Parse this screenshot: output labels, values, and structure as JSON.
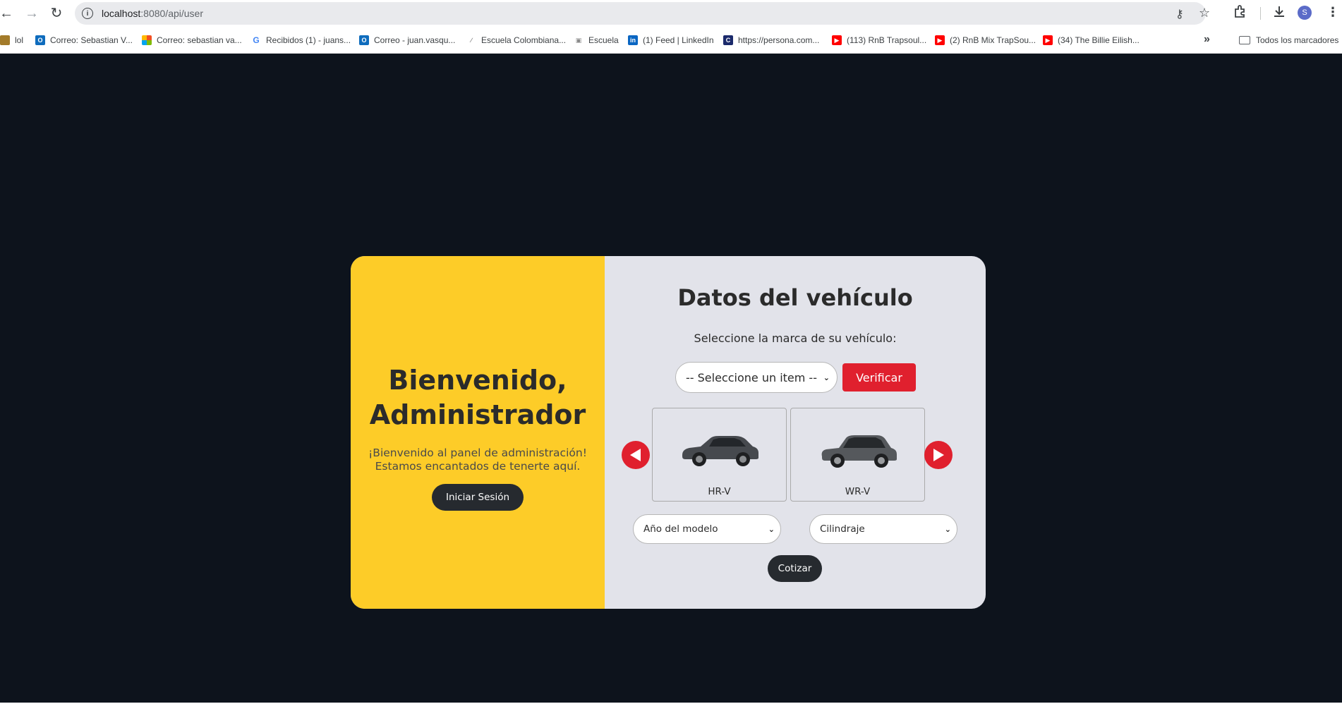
{
  "browser": {
    "url_host": "localhost",
    "url_path": ":8080/api/user",
    "profile_initial": "S",
    "bookmarks": [
      {
        "label": "lol",
        "icon": "lol-favicon"
      },
      {
        "label": "Correo: Sebastian V...",
        "icon": "outlook-icon"
      },
      {
        "label": "Correo: sebastian va...",
        "icon": "microsoft-icon"
      },
      {
        "label": "Recibidos (1) - juans...",
        "icon": "google-icon"
      },
      {
        "label": "Correo - juan.vasqu...",
        "icon": "outlook-icon"
      },
      {
        "label": "Escuela Colombiana...",
        "icon": "escuela-icon"
      },
      {
        "label": "Escuela",
        "icon": "escuela-icon"
      },
      {
        "label": "(1) Feed | LinkedIn",
        "icon": "linkedin-icon"
      },
      {
        "label": "https://persona.com...",
        "icon": "persona-icon"
      },
      {
        "label": "(113) RnB Trapsoul...",
        "icon": "youtube-icon"
      },
      {
        "label": "(2) RnB Mix TrapSou...",
        "icon": "youtube-icon"
      },
      {
        "label": "(34) The Billie Eilish...",
        "icon": "youtube-icon"
      }
    ],
    "all_bookmarks_label": "Todos los marcadores"
  },
  "welcome": {
    "title_line1": "Bienvenido,",
    "title_line2": "Administrador",
    "text": "¡Bienvenido al panel de administración! Estamos encantados de tenerte aquí.",
    "login_button": "Iniciar Sesión"
  },
  "vehicle_form": {
    "title": "Datos del vehículo",
    "subtitle": "Seleccione la marca de su vehículo:",
    "brand_select_value": "-- Seleccione un item --",
    "verify_button": "Verificar",
    "cars": [
      {
        "label": "HR-V",
        "color": "#4a4d52"
      },
      {
        "label": "WR-V",
        "color": "#55585c"
      }
    ],
    "year_select_value": "Año del modelo",
    "cylinder_select_value": "Cilindraje",
    "quote_button": "Cotizar"
  },
  "colors": {
    "page_bg": "#0d131c",
    "accent_yellow": "#fdcc28",
    "accent_red": "#e0202e",
    "dark_button": "#262a2f",
    "form_bg": "#e2e3ea"
  }
}
